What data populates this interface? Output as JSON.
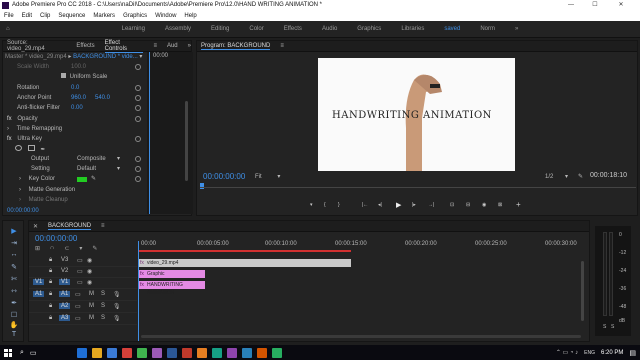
{
  "window": {
    "title": "Adobe Premiere Pro CC 2018 - C:\\Users\\naDiI\\Documents\\Adobe\\Premiere Pro\\12.0\\HAND WRITING ANIMATION *",
    "minimize": "—",
    "maximize": "☐",
    "close": "✕"
  },
  "menu": [
    "File",
    "Edit",
    "Clip",
    "Sequence",
    "Markers",
    "Graphics",
    "Window",
    "Help"
  ],
  "workspaces": {
    "items": [
      "Learning",
      "Assembly",
      "Editing",
      "Color",
      "Effects",
      "Audio",
      "Graphics",
      "Libraries",
      "saved",
      "Norm"
    ],
    "active_index": 8,
    "more": "»"
  },
  "source_panel": {
    "tabs": [
      "Source: video_29.mp4",
      "Effects",
      "Effect Controls",
      "Aud"
    ],
    "active_tab": 2,
    "menu": "≡",
    "more": "»",
    "master": "Master * video_29.mp4",
    "arrow": "▸",
    "clip": "BACKGROUND * vide...",
    "dropdown": "▾",
    "ruler_time": "00:00",
    "params": [
      {
        "label": "Scale Width",
        "value": "100.0",
        "dim": true
      },
      {
        "label": "Uniform Scale",
        "checkbox": true
      },
      {
        "label": "Rotation",
        "value": "0.0"
      },
      {
        "label": "Anchor Point",
        "value": "960.0",
        "value2": "540.0"
      },
      {
        "label": "Anti-flicker Filter",
        "value": "0.00"
      },
      {
        "label": "Opacity",
        "fx": true
      },
      {
        "label": "Time Remapping",
        "fx": true
      },
      {
        "label": "Ultra Key",
        "fx": true
      },
      {
        "label": "Output",
        "value": "Composite",
        "dropdown": true
      },
      {
        "label": "Setting",
        "value": "Default",
        "dropdown": true
      },
      {
        "label": "Key Color",
        "color": "#22cc22"
      },
      {
        "label": "Matte Generation"
      },
      {
        "label": "Matte Cleanup"
      }
    ],
    "timecode": "00:00:00:00"
  },
  "program": {
    "tab": "Program: BACKGROUND",
    "menu": "≡",
    "frame_text": "HANDWRITING ANIMATION",
    "timecode": "00:00:00:00",
    "fit": "Fit",
    "fraction": "1/2",
    "duration": "00:00:18:10",
    "controls": [
      "▾",
      "{",
      "}",
      "|←",
      "◂|",
      "▶",
      "|▸",
      "→|",
      "⊡",
      "⊟",
      "◉",
      "⊠",
      "+"
    ]
  },
  "timeline": {
    "sequence": "BACKGROUND",
    "close": "✕",
    "menu": "≡",
    "timecode": "00:00:00:00",
    "ruler": [
      "00:00",
      "00:00:05:00",
      "00:00:10:00",
      "00:00:15:00",
      "00:00:20:00",
      "00:00:25:00",
      "00:00:30:00"
    ],
    "tracks": [
      {
        "name": "V3",
        "kind": "video"
      },
      {
        "name": "V2",
        "kind": "video"
      },
      {
        "name": "V1",
        "kind": "video",
        "src": "V1"
      },
      {
        "name": "A1",
        "kind": "audio",
        "src": "A1"
      },
      {
        "name": "A2",
        "kind": "audio"
      },
      {
        "name": "A3",
        "kind": "audio"
      }
    ],
    "clips": [
      {
        "label": "video_29.mp4",
        "color": "#c9c9c9",
        "fx": "fx"
      },
      {
        "label": "Graphic",
        "color": "#e48ae4",
        "fx": "fx"
      },
      {
        "label": "HANDWRITING ANIMATION",
        "color": "#e48ae4",
        "fx": "fx"
      }
    ],
    "audio_buttons": [
      "M",
      "S"
    ],
    "meter_scale": [
      "0",
      "-12",
      "-24",
      "-36",
      "-48",
      "dB"
    ],
    "meter_labels": [
      "S",
      "S"
    ]
  },
  "tools": [
    "▶",
    "⇥",
    "↔",
    "✎",
    "✄",
    "⇿",
    "✒",
    "☐",
    "✋",
    "T"
  ],
  "taskbar": {
    "time": "6:20 PM",
    "lang": "ENG",
    "icons": [
      "#1f6fd6",
      "#e6a820",
      "#3a7ad6",
      "#d6403a",
      "#3fb34f",
      "#9b59b6",
      "#2b5797",
      "#c0392b",
      "#e67e22",
      "#16a085",
      "#8e44ad",
      "#2980b9",
      "#d35400",
      "#27ae60"
    ]
  },
  "colors": {
    "accent": "#3f8fe6",
    "playhead": "#3f8fe6",
    "work_area": "#d03030",
    "key_color": "#22cc22"
  }
}
